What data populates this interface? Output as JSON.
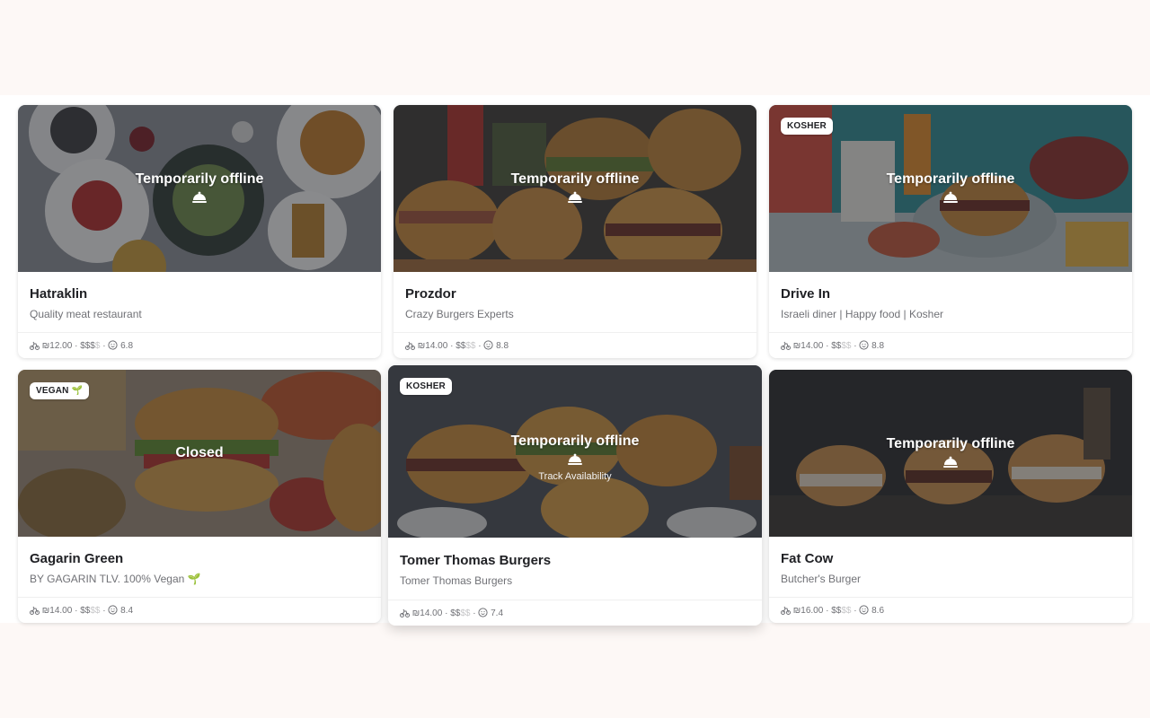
{
  "restaurants": [
    {
      "name": "Hatraklin",
      "description": "Quality meat restaurant",
      "status": "Temporarily offline",
      "tag": "",
      "delivery_fee": "₪12.00",
      "price_active": "$$$",
      "price_inactive": "$",
      "rating": "6.8",
      "track": ""
    },
    {
      "name": "Prozdor",
      "description": "Crazy Burgers Experts",
      "status": "Temporarily offline",
      "tag": "",
      "delivery_fee": "₪14.00",
      "price_active": "$$",
      "price_inactive": "$$",
      "rating": "8.8",
      "track": ""
    },
    {
      "name": "Drive In",
      "description": "Israeli diner | Happy food | Kosher",
      "status": "Temporarily offline",
      "tag": "KOSHER",
      "delivery_fee": "₪14.00",
      "price_active": "$$",
      "price_inactive": "$$",
      "rating": "8.8",
      "track": ""
    },
    {
      "name": "Gagarin Green",
      "description": "BY GAGARIN TLV. 100% Vegan 🌱",
      "status": "Closed",
      "tag": "VEGAN 🌱",
      "delivery_fee": "₪14.00",
      "price_active": "$$",
      "price_inactive": "$$",
      "rating": "8.4",
      "track": ""
    },
    {
      "name": "Tomer Thomas Burgers",
      "description": "Tomer Thomas Burgers",
      "status": "Temporarily offline",
      "tag": "KOSHER",
      "delivery_fee": "₪14.00",
      "price_active": "$$",
      "price_inactive": "$$",
      "rating": "7.4",
      "track": "Track Availability"
    },
    {
      "name": "Fat Cow",
      "description": "Butcher's Burger",
      "status": "Temporarily offline",
      "tag": "",
      "delivery_fee": "₪16.00",
      "price_active": "$$",
      "price_inactive": "$$",
      "rating": "8.6",
      "track": ""
    }
  ],
  "icons": {
    "delivery": "scooter-icon",
    "rating": "smiley-icon",
    "status": "cloche-icon"
  },
  "colors": {
    "page_background": "#fdf8f6",
    "text_primary": "#202125",
    "text_secondary": "#707176"
  }
}
